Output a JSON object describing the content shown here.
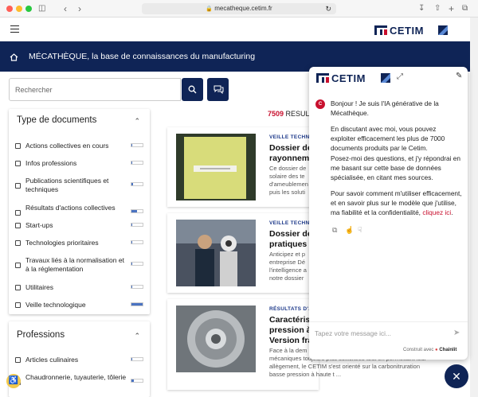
{
  "browser": {
    "url": "mecatheque.cetim.fr",
    "traffic_lights": [
      "#ff5f57",
      "#febc2e",
      "#28c840"
    ]
  },
  "header": {
    "logo_text": "CETIM",
    "nav_title": "MÉCATHÈQUE, la base de connaissances du manufacturing"
  },
  "search": {
    "placeholder": "Rechercher"
  },
  "filters": {
    "doc_types": {
      "title": "Type de documents",
      "items": [
        {
          "label": "Actions collectives en cours",
          "fill": 0.05
        },
        {
          "label": "Infos professions",
          "fill": 0.05
        },
        {
          "label": "Publications scientifiques et techniques",
          "fill": 0.15
        },
        {
          "label": "Résultats d'actions collectives",
          "fill": 0.5
        },
        {
          "label": "Start-ups",
          "fill": 0.05
        },
        {
          "label": "Technologies prioritaires",
          "fill": 0.05
        },
        {
          "label": "Travaux liés à la normalisation et à la réglementation",
          "fill": 0.08
        },
        {
          "label": "Utilitaires",
          "fill": 0.05
        },
        {
          "label": "Veille technologique",
          "fill": 1.0
        }
      ]
    },
    "professions": {
      "title": "Professions",
      "items": [
        {
          "label": "Articles culinaires",
          "fill": 0.05
        },
        {
          "label": "Chaudronnerie, tuyauterie, tôlerie",
          "fill": 0.2
        }
      ]
    }
  },
  "results": {
    "count_number": "7509",
    "count_label": "RESULT",
    "cards": [
      {
        "tag": "VEILLE TECHN",
        "title_lines": [
          "Dossier de",
          "rayonneme"
        ],
        "desc_lines": [
          "Ce dossier de",
          "solaire des te",
          "d'ameublemen",
          "puis les soluti"
        ]
      },
      {
        "tag": "VEILLE TECHN",
        "title_lines": [
          "Dossier de",
          "pratiques p"
        ],
        "desc_lines": [
          "Anticipez et p",
          "entreprise Dé",
          "l'intelligence a",
          "notre dossier"
        ]
      },
      {
        "tag": "RÉSULTATS D'A",
        "title_lines": [
          "Caractéris",
          "pression à l",
          "Version fran"
        ],
        "desc_lines": [
          "Face à la dem",
          "mécaniques toujours plus sollicitées tout en permettant leur",
          "allègement, le CETIM s'est orienté sur la carbonitruration",
          "basse pression à haute t ..."
        ]
      }
    ]
  },
  "chat": {
    "logo_text": "CETIM",
    "avatar_text": "C",
    "greeting": "Bonjour ! Je suis l'IA générative de la Mécathèque.",
    "para2": "En discutant avec moi, vous pouvez exploiter efficacement les plus de 7000 documents produits par le Cetim.",
    "para3": "Posez-moi des questions, et j'y répondrai en me basant sur cette base de données spécialisée, en citant mes sources.",
    "para4": "Pour savoir comment m'utiliser efficacement, et en savoir plus sur le modèle que j'utilise, ma fiabilité et la confidentialité,",
    "para4_link": "cliquez ici",
    "para4_end": ".",
    "input_placeholder": "Tapez votre message ici...",
    "built_with": "Construit avec",
    "built_brand": "Chainlit"
  },
  "colors": {
    "navy": "#0f2456",
    "accent_red": "#c8102e",
    "bar_blue": "#4a73c2"
  }
}
